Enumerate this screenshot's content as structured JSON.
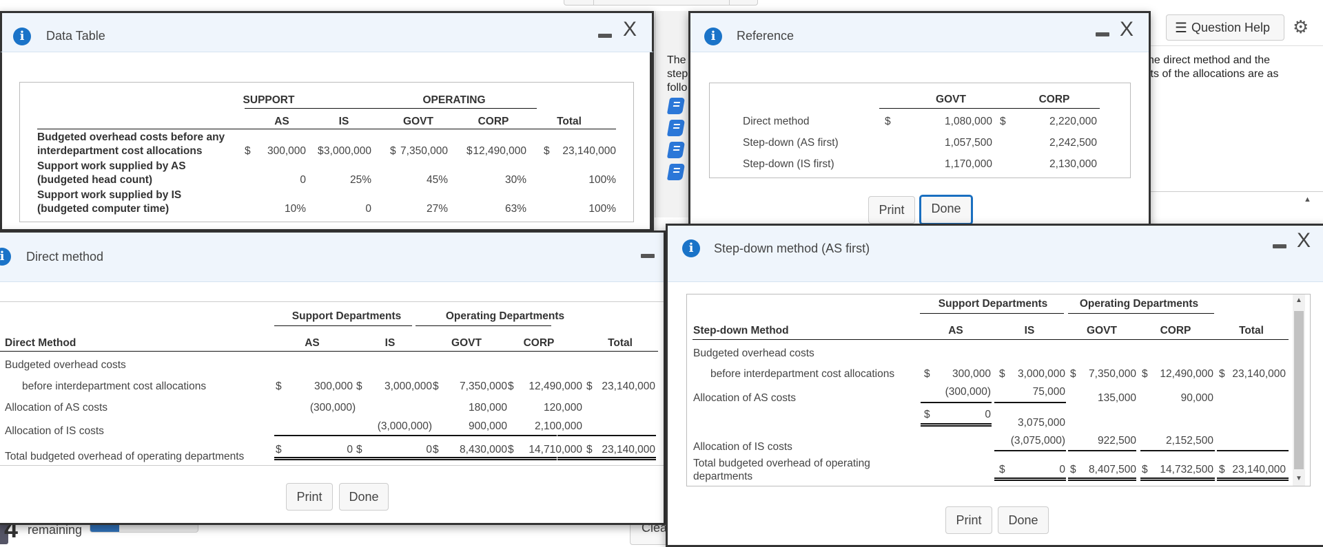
{
  "background": {
    "question_help_label": "Question Help",
    "question_text_right": "he direct method and the\nlts of the allocations are as",
    "question_text_left": "The\nstep\nfollo",
    "remaining_count": "4",
    "remaining_label": "remaining",
    "progress_fraction": 0.27,
    "clear_label": "Clea"
  },
  "data_table": {
    "title": "Data Table",
    "group_headers": [
      "SUPPORT",
      "OPERATING"
    ],
    "columns": [
      "AS",
      "IS",
      "GOVT",
      "CORP",
      "Total"
    ],
    "rows": [
      {
        "label1": "Budgeted overhead costs before any",
        "label2": "interdepartment cost allocations",
        "dollar": true,
        "values": [
          "300,000",
          "3,000,000",
          "7,350,000",
          "12,490,000",
          "23,140,000"
        ]
      },
      {
        "label1": "Support work supplied by AS",
        "label2": "(budgeted head count)",
        "dollar": false,
        "values": [
          "0",
          "25%",
          "45%",
          "30%",
          "100%"
        ]
      },
      {
        "label1": "Support work supplied by IS",
        "label2": "(budgeted computer time)",
        "dollar": false,
        "values": [
          "10%",
          "0",
          "27%",
          "63%",
          "100%"
        ]
      }
    ]
  },
  "reference": {
    "title": "Reference",
    "columns": [
      "GOVT",
      "CORP"
    ],
    "rows": [
      {
        "label": "Direct method",
        "govt": "1,080,000",
        "corp": "2,220,000"
      },
      {
        "label": "Step-down (AS first)",
        "govt": "1,057,500",
        "corp": "2,242,500"
      },
      {
        "label": "Step-down (IS first)",
        "govt": "1,170,000",
        "corp": "2,130,000"
      }
    ],
    "print_label": "Print",
    "done_label": "Done"
  },
  "direct": {
    "title": "Direct method",
    "group_headers": [
      "Support Departments",
      "Operating Departments"
    ],
    "row_header": "Direct Method",
    "columns": [
      "AS",
      "IS",
      "GOVT",
      "CORP",
      "Total"
    ],
    "row_budget_1": "Budgeted overhead costs",
    "row_budget_2": "before interdepartment cost allocations",
    "budget_values": [
      "300,000",
      "3,000,000",
      "7,350,000",
      "12,490,000",
      "23,140,000"
    ],
    "row_as": "Allocation of AS costs",
    "as_values": [
      "(300,000)",
      "",
      "180,000",
      "120,000",
      ""
    ],
    "row_is": "Allocation of IS costs",
    "is_values": [
      "",
      "(3,000,000)",
      "900,000",
      "2,100,000",
      ""
    ],
    "row_total": "Total budgeted overhead of operating departments",
    "total_values": [
      "0",
      "0",
      "8,430,000",
      "14,710,000",
      "23,140,000"
    ],
    "print_label": "Print",
    "done_label": "Done"
  },
  "stepdown": {
    "title": "Step-down method (AS first)",
    "group_headers": [
      "Support Departments",
      "Operating Departments"
    ],
    "row_header": "Step-down Method",
    "columns": [
      "AS",
      "IS",
      "GOVT",
      "CORP",
      "Total"
    ],
    "row_budget_1": "Budgeted overhead costs",
    "row_budget_2": "before interdepartment cost allocations",
    "budget_values": [
      "300,000",
      "3,000,000",
      "7,350,000",
      "12,490,000",
      "23,140,000"
    ],
    "row_as": "Allocation of AS costs",
    "as_values": [
      "(300,000)",
      "75,000",
      "135,000",
      "90,000",
      ""
    ],
    "as_subtotal": "0",
    "is_subtotal": "3,075,000",
    "row_is": "Allocation of IS costs",
    "is_values": [
      "",
      "(3,075,000)",
      "922,500",
      "2,152,500",
      ""
    ],
    "row_total_1": "Total budgeted overhead of operating",
    "row_total_2": "departments",
    "total_values": [
      "0",
      "8,407,500",
      "14,732,500",
      "23,140,000"
    ],
    "print_label": "Print",
    "done_label": "Done"
  },
  "dollar": "$"
}
